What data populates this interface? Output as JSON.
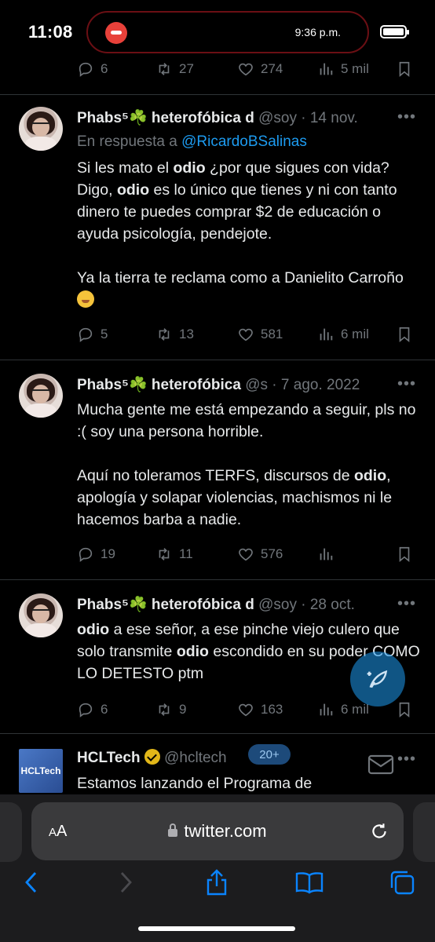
{
  "status_bar": {
    "time": "11:08",
    "island_time": "9:36 p.m."
  },
  "top_actions": {
    "replies": "6",
    "retweets": "27",
    "likes": "274",
    "views": "5 mil"
  },
  "tweets": [
    {
      "name": "Phabs⁵",
      "clover": "☘️",
      "display_suffix": "heterofóbica d",
      "handle": "@soy",
      "date": "· 14 nov.",
      "reply_prefix": "En respuesta a",
      "reply_to": "@RicardoBSalinas",
      "p1_a": "Si les mato el ",
      "p1_b": "odio",
      "p1_c": " ¿por que sigues con vida? Digo, ",
      "p1_d": "odio",
      "p1_e": " es lo único que tienes y ni con tanto dinero te puedes comprar $2 de educación o ayuda psicología, pendejote.",
      "p2": "Ya la tierra te reclama como a Danielito Carroño",
      "replies": "5",
      "retweets": "13",
      "likes": "581",
      "views": "6 mil"
    },
    {
      "name": "Phabs⁵",
      "clover": "☘️",
      "display_suffix": "heterofóbica",
      "handle": "@s",
      "date": "· 7 ago. 2022",
      "p1": "Mucha gente me está empezando a seguir, pls no :( soy una persona horrible.",
      "p2_a": "Aquí no toleramos TERFS, discursos de ",
      "p2_b": "odio",
      "p2_c": ", apología y solapar violencias, machismos ni le hacemos barba a nadie.",
      "replies": "19",
      "retweets": "11",
      "likes": "576",
      "views": ""
    },
    {
      "name": "Phabs⁵",
      "clover": "☘️",
      "display_suffix": "heterofóbica d",
      "handle": "@soy",
      "date": "· 28 oct.",
      "p1_a": "odio",
      "p1_b": " a ese señor, a ese pinche viejo culero que solo transmite ",
      "p1_c": "odio",
      "p1_d": " escondido en su poder COMO LO DETESTO ptm",
      "replies": "6",
      "retweets": "9",
      "likes": "163",
      "views": "6 mil"
    }
  ],
  "ad": {
    "logo_text": "HCLTech",
    "name": "HCLTech",
    "handle": "@hcltech",
    "badge": "20+",
    "text": "Estamos lanzando el Programa de"
  },
  "safari": {
    "aa_label_small": "A",
    "aa_label_big": "A",
    "url": "twitter.com"
  },
  "colors": {
    "accent": "#1d9bf0",
    "muted": "#71767b",
    "clover": "#3fae4a"
  }
}
